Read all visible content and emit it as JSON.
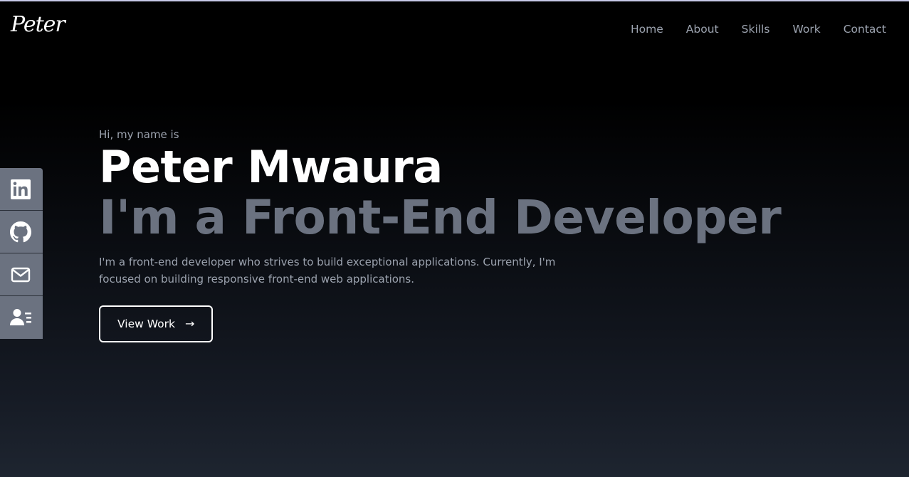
{
  "brand": {
    "logo": "Peter"
  },
  "nav": {
    "items": [
      {
        "label": "Home"
      },
      {
        "label": "About"
      },
      {
        "label": "Skills"
      },
      {
        "label": "Work"
      },
      {
        "label": "Contact"
      }
    ]
  },
  "social": {
    "icons": [
      "linkedin-icon",
      "github-icon",
      "mail-icon",
      "resume-icon"
    ],
    "color": "#6b7280"
  },
  "hero": {
    "greeting": "Hi, my name is",
    "name": "Peter Mwaura",
    "role": "I'm a Front-End Developer",
    "description": "I'm a front-end developer who strives to build exceptional applications. Currently, I'm focused on building responsive front-end web applications.",
    "cta_label": "View Work",
    "cta_icon": "arrow-right-icon"
  },
  "colors": {
    "accent_gray": "#6b7280",
    "muted_text": "#9ca3af",
    "background_top": "#000000",
    "background_bottom": "#1e2530"
  }
}
